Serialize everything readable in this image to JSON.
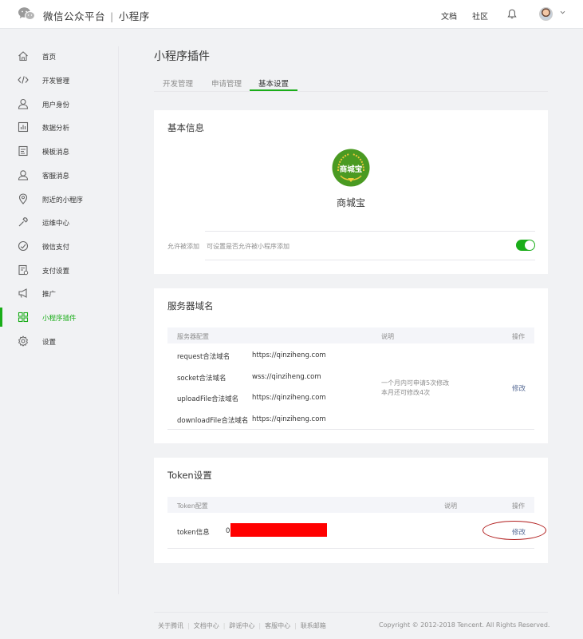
{
  "header": {
    "brand": "微信公众平台",
    "separator": "|",
    "product": "小程序",
    "nav": [
      "文档",
      "社区"
    ]
  },
  "sidebar": {
    "items": [
      {
        "label": "首页",
        "icon": "home-icon"
      },
      {
        "label": "开发管理",
        "icon": "code-icon"
      },
      {
        "label": "用户身份",
        "icon": "user-icon"
      },
      {
        "label": "数据分析",
        "icon": "bar-chart-icon"
      },
      {
        "label": "模板消息",
        "icon": "document-icon"
      },
      {
        "label": "客服消息",
        "icon": "headset-user-icon"
      },
      {
        "label": "附近的小程序",
        "icon": "location-pin-icon"
      },
      {
        "label": "运维中心",
        "icon": "wrench-icon"
      },
      {
        "label": "微信支付",
        "icon": "gauge-icon"
      },
      {
        "label": "支付设置",
        "icon": "payment-settings-icon"
      },
      {
        "label": "推广",
        "icon": "megaphone-icon"
      },
      {
        "label": "小程序插件",
        "icon": "plugin-grid-icon",
        "active": true
      },
      {
        "label": "设置",
        "icon": "gear-icon"
      }
    ]
  },
  "page": {
    "title": "小程序插件",
    "tabs": [
      {
        "label": "开发管理"
      },
      {
        "label": "申请管理"
      },
      {
        "label": "基本设置",
        "active": true
      }
    ]
  },
  "basic_info": {
    "title": "基本信息",
    "logo_text": "商城宝",
    "plugin_name": "商城宝",
    "allow_label": "允许被添加",
    "allow_desc": "可设置是否允许被小程序添加",
    "allow_enabled": true
  },
  "server_domains": {
    "title": "服务器域名",
    "headers": [
      "服务器配置",
      "说明",
      "操作"
    ],
    "rows": [
      {
        "name": "request合法域名",
        "value": "https://qinziheng.com"
      },
      {
        "name": "socket合法域名",
        "value": "wss://qinziheng.com"
      },
      {
        "name": "uploadFile合法域名",
        "value": "https://qinziheng.com"
      },
      {
        "name": "downloadFile合法域名",
        "value": "https://qinziheng.com"
      }
    ],
    "note_line1": "一个月内可申请5次修改",
    "note_line2": "本月还可修改4次",
    "action": "修改"
  },
  "token": {
    "title": "Token设置",
    "headers": [
      "Token配置",
      "说明",
      "操作"
    ],
    "row_label": "token信息",
    "row_value": "0",
    "action": "修改"
  },
  "footer": {
    "links": [
      "关于腾讯",
      "文档中心",
      "辟谣中心",
      "客服中心",
      "联系邮箱"
    ],
    "copyright": "Copyright © 2012-2018 Tencent. All Rights Reserved."
  },
  "colors": {
    "accent": "#1aad19",
    "link": "#576b95",
    "redaction": "#ff0000",
    "annotation": "#b11d1d"
  }
}
